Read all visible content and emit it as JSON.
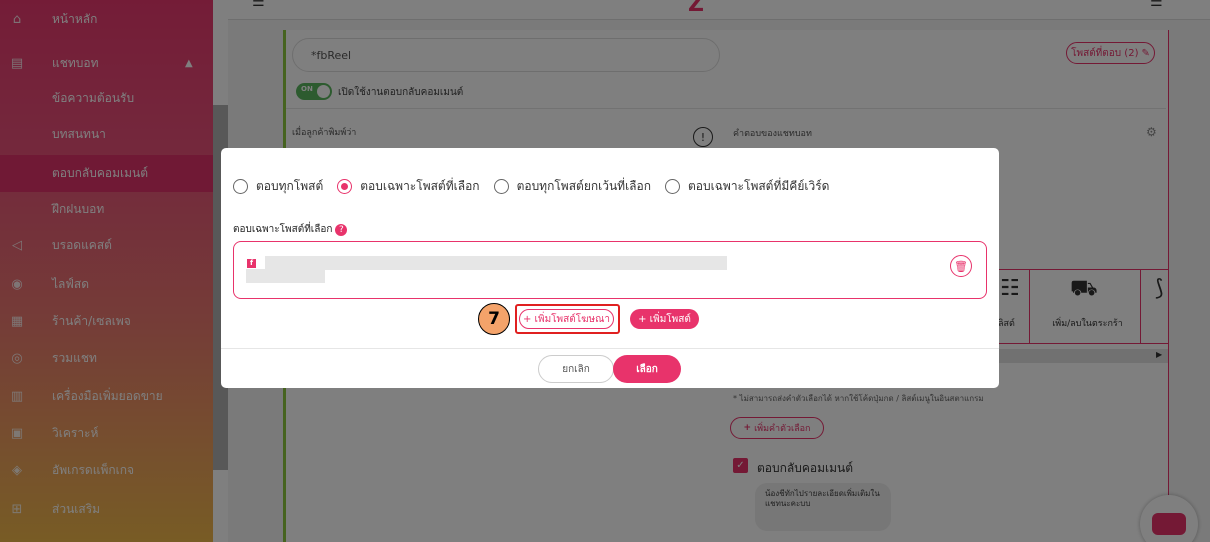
{
  "sidebar": {
    "items": [
      {
        "label": "หน้าหลัก",
        "icon": "home-icon"
      },
      {
        "label": "แชทบอท",
        "icon": "chat-icon"
      },
      {
        "label": "ข้อความต้อนรับ"
      },
      {
        "label": "บทสนทนา"
      },
      {
        "label": "ตอบกลับคอมเมนต์"
      },
      {
        "label": "ฝึกฝนบอท"
      },
      {
        "label": "บรอดแคสต์",
        "icon": "megaphone-icon"
      },
      {
        "label": "ไลฟ์สด",
        "icon": "broadcast-icon"
      },
      {
        "label": "ร้านค้า/เซลเพจ",
        "icon": "store-icon"
      },
      {
        "label": "รวมแชท",
        "icon": "chats-icon"
      },
      {
        "label": "เครื่องมือเพิ่มยอดขาย",
        "icon": "chart-icon"
      },
      {
        "label": "วิเคราะห์",
        "icon": "analytics-icon"
      },
      {
        "label": "อัพเกรดแพ็กเกจ",
        "icon": "badge-icon"
      },
      {
        "label": "ส่วนเสริม",
        "icon": "plugin-icon"
      }
    ],
    "active": "ตอบกลับคอมเมนต์"
  },
  "background": {
    "name_input": "*fbReel",
    "reply_count": "โพสต์ที่ตอบ (2)",
    "toggle_text": "ON",
    "toggle_label": "เปิดใช้งานตอบกลับคอมเมนต์",
    "left_header": "เมื่อลูกค้าพิมพ์ว่า",
    "right_header": "คำตอบของแชทบอท",
    "cart_label": "เพิ่ม/ลบในตระกร้า",
    "list_label": "ลิสต์",
    "note": "* ไม่สามารถส่งคำตัวเลือกได้ หากใช้โค้ดปุ่มกด / ลิสต์เมนูในอินสตาแกรม",
    "add_choice": "เพิ่มคำตัวเลือก",
    "checkbox_label": "ตอบกลับคอมเมนต์",
    "bubble_text": "น้องชีทักไปรายละเอียดเพิ่มเติมในแชทนะคะบบ"
  },
  "modal": {
    "options": [
      "ตอบทุกโพสต์",
      "ตอบเฉพาะโพสต์ที่เลือก",
      "ตอบทุกโพสต์ยกเว้นที่เลือก",
      "ตอบเฉพาะโพสต์ที่มีคีย์เวิร์ด"
    ],
    "selected_option": "ตอบเฉพาะโพสต์ที่เลือก",
    "section_label": "ตอบเฉพาะโพสต์ที่เลือก",
    "btn_add_ad": "+ เพิ่มโพสต์โฆษณา",
    "btn_add_post": "+ เพิ่มโพสต์",
    "btn_cancel": "ยกเลิก",
    "btn_select": "เลือก",
    "step_number": "7"
  },
  "colors": {
    "accent": "#e8336b",
    "highlight": "#e02020",
    "step_badge": "#f4a36a"
  }
}
